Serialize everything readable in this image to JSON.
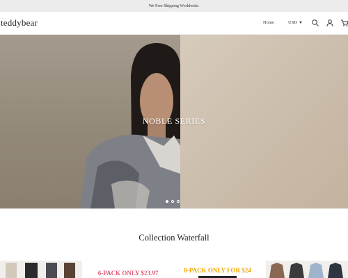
{
  "announcement": {
    "text": "We Free Shipping Worldwide."
  },
  "header": {
    "logo": "teddybear",
    "nav": {
      "home": "Home"
    },
    "currency": "USD",
    "icons": [
      "search-icon",
      "account-icon",
      "cart-icon"
    ]
  },
  "hero": {
    "title": "NOBLE SERIES",
    "slides_count": 3,
    "active_slide": 1
  },
  "collection": {
    "title": "Collection Waterfall",
    "tiles": [
      {
        "kind": "image",
        "icon": "pants-product-image"
      },
      {
        "kind": "promo",
        "text": "6-PACK ONLY $23.97",
        "color": "#e05a78"
      },
      {
        "kind": "promo",
        "text": "8-PACK ONLY FOR $24",
        "color": "#f2a400"
      },
      {
        "kind": "image",
        "icon": "jackets-product-image"
      }
    ]
  },
  "colors": {
    "announcement_bg": "#ececec",
    "text": "#222222",
    "hero_title": "#ffffff"
  }
}
